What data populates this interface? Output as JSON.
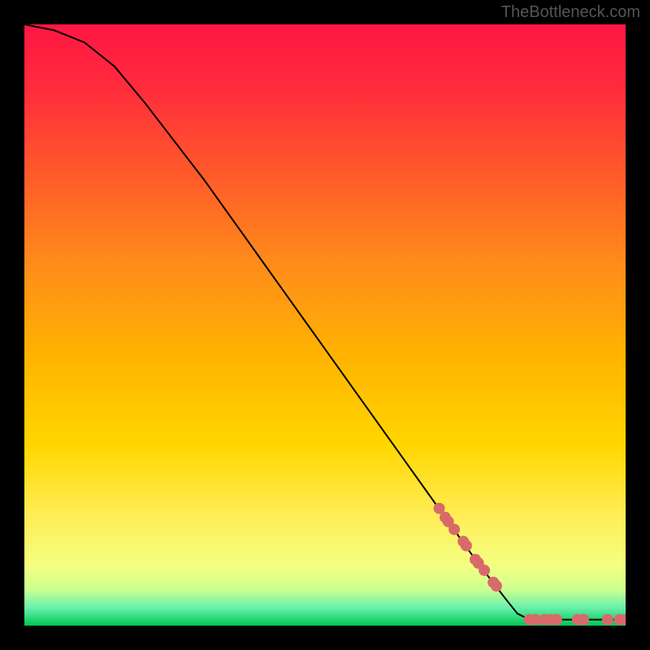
{
  "watermark": "TheBottleneck.com",
  "chart_data": {
    "type": "line",
    "title": "",
    "xlabel": "",
    "ylabel": "",
    "xlim": [
      0,
      100
    ],
    "ylim": [
      0,
      100
    ],
    "curve": [
      {
        "x": 0,
        "y": 100
      },
      {
        "x": 5,
        "y": 99
      },
      {
        "x": 10,
        "y": 97
      },
      {
        "x": 15,
        "y": 93
      },
      {
        "x": 20,
        "y": 87
      },
      {
        "x": 25,
        "y": 80.5
      },
      {
        "x": 30,
        "y": 74
      },
      {
        "x": 35,
        "y": 67
      },
      {
        "x": 40,
        "y": 60
      },
      {
        "x": 45,
        "y": 53
      },
      {
        "x": 50,
        "y": 46
      },
      {
        "x": 55,
        "y": 39
      },
      {
        "x": 60,
        "y": 32
      },
      {
        "x": 65,
        "y": 25
      },
      {
        "x": 70,
        "y": 18
      },
      {
        "x": 75,
        "y": 11
      },
      {
        "x": 80,
        "y": 4.5
      },
      {
        "x": 82,
        "y": 2
      },
      {
        "x": 84,
        "y": 1
      },
      {
        "x": 100,
        "y": 1
      }
    ],
    "markers": [
      {
        "x": 69,
        "y": 19.5
      },
      {
        "x": 70,
        "y": 18
      },
      {
        "x": 70.5,
        "y": 17.3
      },
      {
        "x": 71.5,
        "y": 16
      },
      {
        "x": 73,
        "y": 14
      },
      {
        "x": 73.5,
        "y": 13.3
      },
      {
        "x": 75,
        "y": 11
      },
      {
        "x": 75.5,
        "y": 10.4
      },
      {
        "x": 76.5,
        "y": 9.2
      },
      {
        "x": 78,
        "y": 7.2
      },
      {
        "x": 78.5,
        "y": 6.6
      },
      {
        "x": 84,
        "y": 1
      },
      {
        "x": 85,
        "y": 1
      },
      {
        "x": 86.5,
        "y": 1
      },
      {
        "x": 87.5,
        "y": 1
      },
      {
        "x": 88.5,
        "y": 1
      },
      {
        "x": 92,
        "y": 1
      },
      {
        "x": 93,
        "y": 1
      },
      {
        "x": 97,
        "y": 1
      },
      {
        "x": 99,
        "y": 1
      },
      {
        "x": 100,
        "y": 1
      }
    ],
    "marker_color": "#d96a6a",
    "marker_radius": 7,
    "line_color": "#000000",
    "gradient_stops": [
      {
        "offset": 0.0,
        "color": "#ff1744"
      },
      {
        "offset": 0.1,
        "color": "#ff2a3c"
      },
      {
        "offset": 0.25,
        "color": "#ff5a2a"
      },
      {
        "offset": 0.4,
        "color": "#ff8c1a"
      },
      {
        "offset": 0.55,
        "color": "#ffb300"
      },
      {
        "offset": 0.7,
        "color": "#ffd600"
      },
      {
        "offset": 0.82,
        "color": "#ffee58"
      },
      {
        "offset": 0.9,
        "color": "#f4ff81"
      },
      {
        "offset": 0.94,
        "color": "#ccff90"
      },
      {
        "offset": 0.97,
        "color": "#69f0ae"
      },
      {
        "offset": 1.0,
        "color": "#00c853"
      }
    ]
  }
}
